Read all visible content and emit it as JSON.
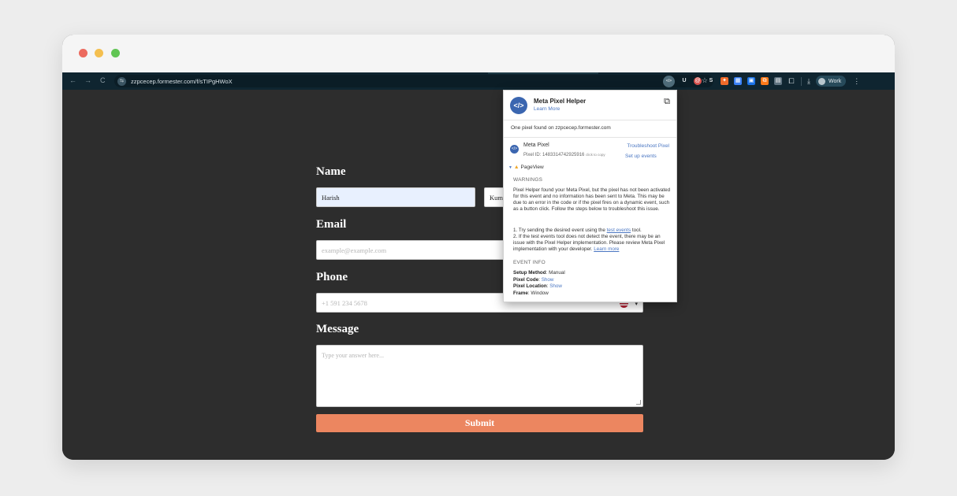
{
  "browser": {
    "url": "zzpcecep.formester.com/f/sTIPgHWoX",
    "site_icon": "⇆",
    "profile_label": "Work",
    "nav": {
      "back": "←",
      "forward": "→",
      "reload": "C"
    },
    "icons": [
      "star-icon",
      "meta-pixel-helper-icon",
      "puzzle-icon",
      "download-icon",
      "kebab-menu-icon"
    ],
    "extensions": [
      {
        "name": "meta-pixel-helper-ext-icon",
        "glyph": "</>",
        "color": "#4f6c7a"
      },
      {
        "name": "u-ext-icon",
        "glyph": "U"
      },
      {
        "name": "circle-ext-icon",
        "glyph": "@"
      },
      {
        "name": "s-ext-icon",
        "glyph": "S"
      },
      {
        "name": "orange-ext-icon",
        "glyph": "✦"
      },
      {
        "name": "blue-ext-icon",
        "glyph": "▦"
      },
      {
        "name": "blue2-ext-icon",
        "glyph": "▣"
      },
      {
        "name": "orange2-ext-icon",
        "glyph": "⧉"
      },
      {
        "name": "gray-ext-icon",
        "glyph": "▤"
      }
    ]
  },
  "form": {
    "name_label": "Name",
    "first_name_value": "Harish",
    "last_name_value": "Kum",
    "email_label": "Email",
    "email_placeholder": "example@example.com",
    "phone_label": "Phone",
    "phone_placeholder": "+1 591 234 5678",
    "message_label": "Message",
    "message_placeholder": "Type your answer here...",
    "submit_label": "Submit",
    "accent_color": "#ec8660"
  },
  "pixel_helper": {
    "title": "Meta Pixel Helper",
    "learn_more": "Learn More",
    "found_text": "One pixel found on zzpcecep.formester.com",
    "pixel_name": "Meta Pixel",
    "pixel_id": "Pixel ID: 1483314742925916",
    "click_to_copy": "click to copy",
    "troubleshoot": "Troubleshoot Pixel",
    "set_up_events": "Set up events",
    "event_name": "PageView",
    "warnings_heading": "WARNINGS",
    "warning_text": "Pixel Helper found your Meta Pixel, but the pixel has not been activated for this event and no information has been sent to Meta. This may be due to an error in the code or if the pixel fires on a dynamic event, such as a button click. Follow the steps below to troubleshoot this issue.",
    "step1_prefix": "1. Try sending the desired event using the ",
    "step1_link": "test events",
    "step1_suffix": " tool.",
    "step2_text": "2. If the test events tool does not detect the event, there may be an issue with the Pixel Helper implementation. Please review Meta Pixel implementation with your developer. ",
    "step2_link": "Learn more",
    "event_info_heading": "EVENT INFO",
    "setup_method_label": "Setup Method",
    "setup_method_value": "Manual",
    "pixel_code_label": "Pixel Code",
    "pixel_code_value": "Show",
    "pixel_location_label": "Pixel Location",
    "pixel_location_value": "Show",
    "frame_label": "Frame",
    "frame_value": "Window"
  }
}
